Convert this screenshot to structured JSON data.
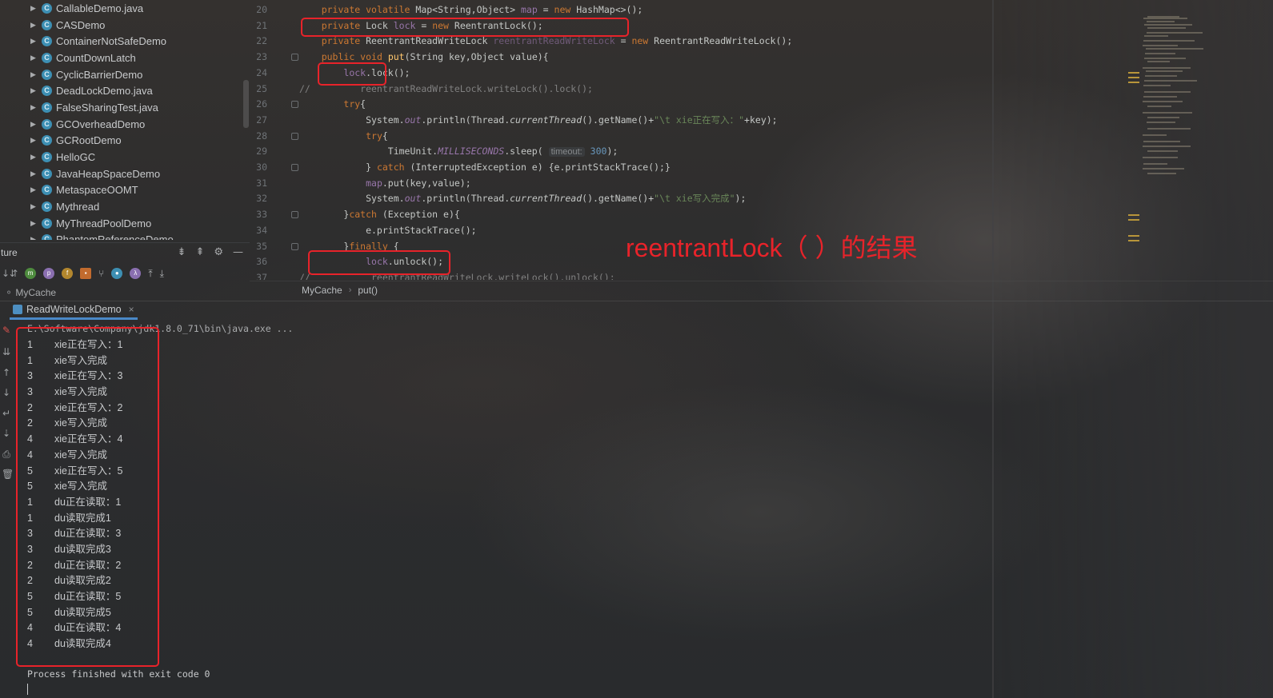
{
  "project_tree": {
    "items": [
      {
        "label": "CallableDemo.java"
      },
      {
        "label": "CASDemo"
      },
      {
        "label": "ContainerNotSafeDemo"
      },
      {
        "label": "CountDownLatch"
      },
      {
        "label": "CyclicBarrierDemo"
      },
      {
        "label": "DeadLockDemo.java"
      },
      {
        "label": "FalseSharingTest.java"
      },
      {
        "label": "GCOverheadDemo"
      },
      {
        "label": "GCRootDemo"
      },
      {
        "label": "HelloGC"
      },
      {
        "label": "JavaHeapSpaceDemo"
      },
      {
        "label": "MetaspaceOOMT"
      },
      {
        "label": "Mythread"
      },
      {
        "label": "MyThreadPoolDemo"
      },
      {
        "label": "PhantomReferenceDemo"
      }
    ],
    "class_icon_letter": "C"
  },
  "structure": {
    "title": "ture",
    "selected": "MyCache"
  },
  "editor": {
    "line_numbers": [
      "20",
      "21",
      "22",
      "23",
      "24",
      "25",
      "26",
      "27",
      "28",
      "29",
      "30",
      "31",
      "32",
      "33",
      "34",
      "35",
      "36",
      "37"
    ],
    "breadcrumb": [
      "MyCache",
      "put()"
    ]
  },
  "run": {
    "tab_label": "ReadWriteLockDemo",
    "command": "E:\\Software\\Company\\jdk1.8.0_71\\bin\\java.exe ...",
    "output": [
      {
        "id": "1",
        "text": "xie正在写入：1"
      },
      {
        "id": "1",
        "text": "xie写入完成"
      },
      {
        "id": "3",
        "text": "xie正在写入：3"
      },
      {
        "id": "3",
        "text": "xie写入完成"
      },
      {
        "id": "2",
        "text": "xie正在写入：2"
      },
      {
        "id": "2",
        "text": "xie写入完成"
      },
      {
        "id": "4",
        "text": "xie正在写入：4"
      },
      {
        "id": "4",
        "text": "xie写入完成"
      },
      {
        "id": "5",
        "text": "xie正在写入：5"
      },
      {
        "id": "5",
        "text": "xie写入完成"
      },
      {
        "id": "1",
        "text": "du正在读取：1"
      },
      {
        "id": "1",
        "text": "du读取完成1"
      },
      {
        "id": "3",
        "text": "du正在读取：3"
      },
      {
        "id": "3",
        "text": "du读取完成3"
      },
      {
        "id": "2",
        "text": "du正在读取：2"
      },
      {
        "id": "2",
        "text": "du读取完成2"
      },
      {
        "id": "5",
        "text": "du正在读取：5"
      },
      {
        "id": "5",
        "text": "du读取完成5"
      },
      {
        "id": "4",
        "text": "du正在读取：4"
      },
      {
        "id": "4",
        "text": "du读取完成4"
      }
    ],
    "exit_message": "Process finished with exit code 0"
  },
  "annotation": {
    "text": "reentrantLock（  ）的结果",
    "color": "#e8232a"
  },
  "colors": {
    "keyword": "#cc7832",
    "field": "#9876aa",
    "string": "#6a8759",
    "method": "#ffc66d",
    "comment": "#808080",
    "tab_underline": "#4a88c7"
  }
}
